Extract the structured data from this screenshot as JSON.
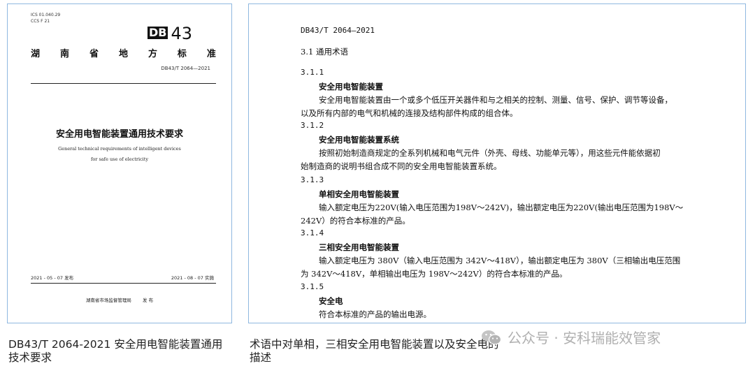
{
  "cover": {
    "ics": "ICS 01.040.29",
    "ccs": "CCS F 21",
    "db_mark": "DB",
    "db_number": "43",
    "standard_type_chars": [
      "湖",
      "南",
      "省",
      "地",
      "方",
      "标",
      "准"
    ],
    "standard_number": "DB43/T 2064—2021",
    "title": "安全用电智能装置通用技术要求",
    "title_en_line1": "General technical requirements of intelligent devices",
    "title_en_line2": "for safe use of electricity",
    "issue_date": "2021 - 05 - 07 发布",
    "impl_date": "2021 - 08 - 07 实施",
    "publisher": "湖南省市场监督管理局",
    "publish_label": "发 布"
  },
  "page": {
    "header": "DB43/T 2064—2021",
    "section": "3.1  通用术语",
    "terms": [
      {
        "num": "3.1.1",
        "name": "安全用电智能装置",
        "def": [
          "安全用电智能装置由一个或多个低压开关器件和与之相关的控制、测量、信号、保护、调节等设备，",
          "以及所有内部的电气和机械的连接及结构部件构成的组合体。"
        ]
      },
      {
        "num": "3.1.2",
        "name": "安全用电智能装置系统",
        "def": [
          "按照初始制造商规定的全系列机械和电气元件（外壳、母线、功能单元等），用这些元件能依据初",
          "始制造商的说明书组合成不同的安全用电智能装置系统。"
        ]
      },
      {
        "num": "3.1.3",
        "name": "单相安全用电智能装置",
        "def": [
          "输入额定电压为220V(输入电压范围为198V～242V)，输出额定电压为220V(输出电压范围为198V～",
          "242V）的符合本标准的产品。"
        ]
      },
      {
        "num": "3.1.4",
        "name": "三相安全用电智能装置",
        "def": [
          "输入额定电压为 380V（输入电压范围为 342V～418V），输出额定电压为 380V（三相输出电压范围",
          "为 342V～418V，单相输出电压为 198V～242V）的符合本标准的产品。"
        ]
      },
      {
        "num": "3.1.5",
        "name": "安全电",
        "def": [
          "符合本标准的产品的输出电源。"
        ]
      }
    ]
  },
  "captions": {
    "left": "DB43/T 2064-2021 安全用电智能装置通用技术要求",
    "right": "术语中对单相，三相安全用电智能装置以及安全电的描述"
  },
  "watermark": {
    "text": "公众号 · 安科瑞能效管家",
    "icon": "wechat-icon"
  }
}
